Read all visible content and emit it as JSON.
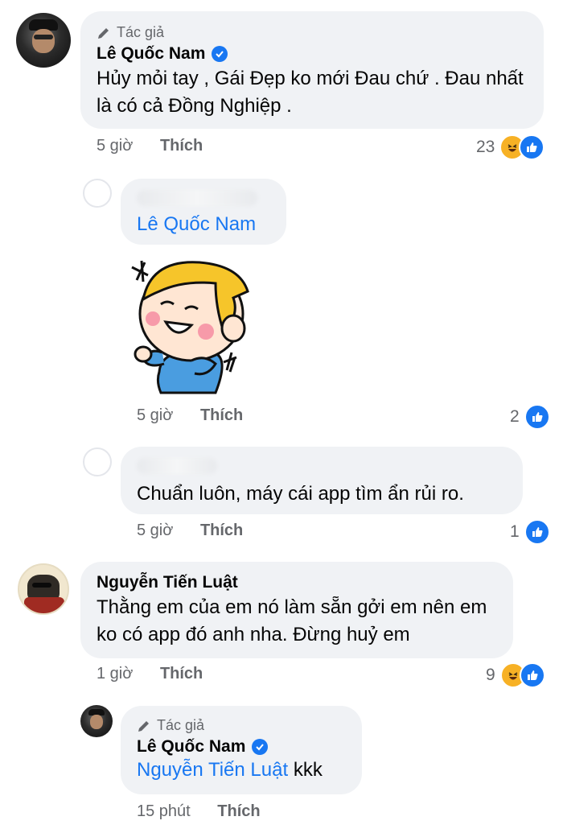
{
  "comments": [
    {
      "role": "Tác giả",
      "name": "Lê Quốc Nam",
      "text": "Hủy mỏi tay , Gái Đẹp ko mới Đau chứ . Đau nhất là có cả Đồng Nghiệp .",
      "time": "5 giờ",
      "like_label": "Thích",
      "reaction_count": "23",
      "reactions": [
        "haha-icon",
        "like-icon"
      ]
    },
    {
      "tag": "Lê Quốc Nam",
      "sticker": "laughing-boy-sticker",
      "time": "5 giờ",
      "like_label": "Thích",
      "reaction_count": "2",
      "reactions": [
        "like-icon"
      ]
    },
    {
      "text": "Chuẩn luôn, máy cái app tìm ẩn rủi ro.",
      "time": "5 giờ",
      "like_label": "Thích",
      "reaction_count": "1",
      "reactions": [
        "like-icon"
      ]
    },
    {
      "name": "Nguyễn Tiến Luật",
      "text": "Thằng em của em nó làm sẵn gởi em nên em ko có app đó anh nha. Đừng huỷ em",
      "time": "1 giờ",
      "like_label": "Thích",
      "reaction_count": "9",
      "reactions": [
        "haha-icon",
        "like-icon"
      ]
    },
    {
      "role": "Tác giả",
      "name": "Lê Quốc Nam",
      "tag": "Nguyễn Tiến Luật",
      "text": "kkk",
      "time": "15 phút",
      "like_label": "Thích"
    }
  ],
  "colors": {
    "accent": "#1877f2",
    "bubble": "#f0f2f5",
    "meta": "#65676b",
    "haha": "#f7b125"
  }
}
